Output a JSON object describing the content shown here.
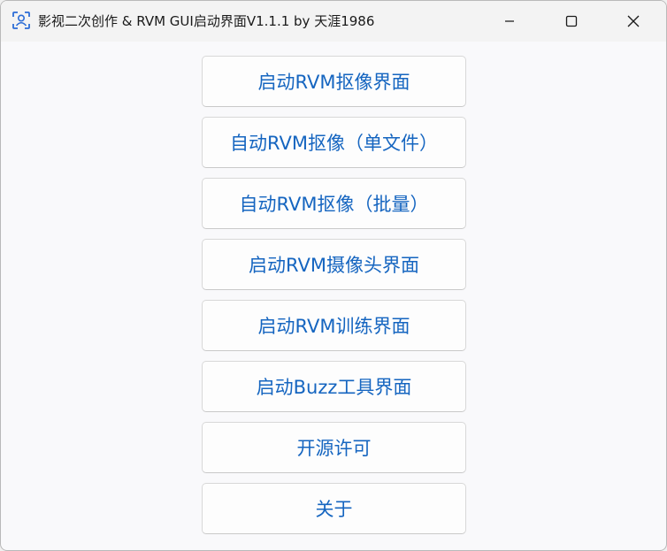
{
  "window": {
    "title": "影视二次创作 & RVM GUI启动界面V1.1.1 by 天涯1986",
    "app_icon": "face-scan-icon",
    "controls": {
      "minimize_icon": "minimize-icon",
      "maximize_icon": "maximize-icon",
      "close_icon": "close-icon"
    }
  },
  "buttons": [
    {
      "label": "启动RVM抠像界面"
    },
    {
      "label": "自动RVM抠像（单文件）"
    },
    {
      "label": "自动RVM抠像（批量）"
    },
    {
      "label": "启动RVM摄像头界面"
    },
    {
      "label": "启动RVM训练界面"
    },
    {
      "label": "启动Buzz工具界面"
    },
    {
      "label": "开源许可"
    },
    {
      "label": "关于"
    }
  ],
  "colors": {
    "button_text": "#1565c0",
    "accent_icon": "#2b6cd6",
    "title_bar": "#f3f3f3",
    "window_bg": "#f9f9fb"
  }
}
